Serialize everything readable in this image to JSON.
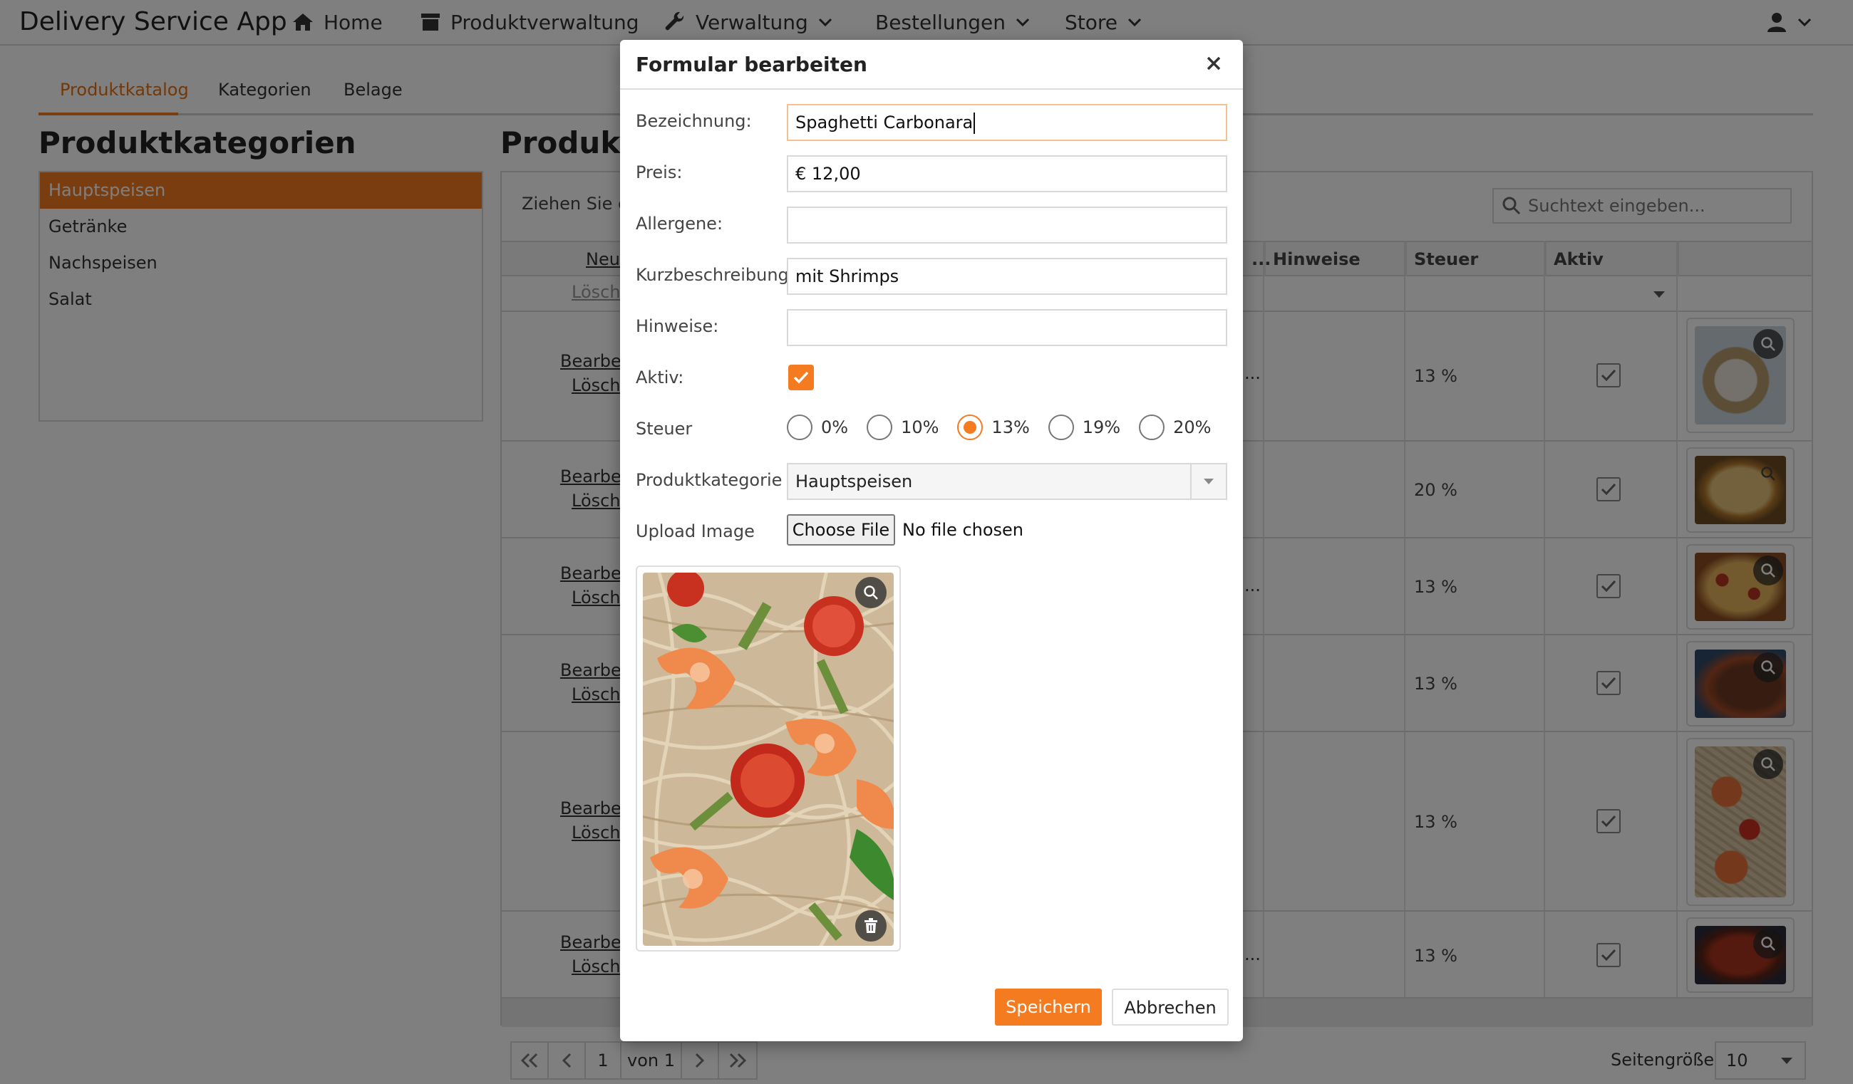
{
  "app": {
    "brand": "Delivery Service App",
    "nav": [
      {
        "label": "Home",
        "icon": "home-icon"
      },
      {
        "label": "Produktverwaltung",
        "icon": "archive-icon"
      },
      {
        "label": "Verwaltung",
        "icon": "wrench-icon"
      },
      {
        "label": "Bestellungen"
      },
      {
        "label": "Store"
      }
    ],
    "user_icon": "user-icon"
  },
  "tabs": [
    {
      "label": "Produktkatalog",
      "active": true
    },
    {
      "label": "Kategorien",
      "active": false
    },
    {
      "label": "Belage",
      "active": false
    }
  ],
  "categories": {
    "title": "Produktkategorien",
    "items": [
      "Hauptspeisen",
      "Getränke",
      "Nachspeisen",
      "Salat"
    ],
    "selected": "Hauptspeisen"
  },
  "products": {
    "title": "Produkte",
    "drag_hint": "Ziehen Sie ei",
    "search_placeholder": "Suchtext eingeben...",
    "header": {
      "new_link": "Neu",
      "ellipsis": "...",
      "hinweise": "Hinweise",
      "steuer": "Steuer",
      "aktiv": "Aktiv"
    },
    "filter_delete": "Lösche",
    "rows": [
      {
        "edit": "Bearbeit",
        "delete": "Lösche",
        "truncated": "...",
        "tax": "13 %",
        "active": true
      },
      {
        "edit": "Bearbeit",
        "delete": "Lösche",
        "truncated": "",
        "tax": "20 %",
        "active": true
      },
      {
        "edit": "Bearbeit",
        "delete": "Lösche",
        "truncated": "...",
        "tax": "13 %",
        "active": true
      },
      {
        "edit": "Bearbeit",
        "delete": "Lösche",
        "truncated": "",
        "tax": "13 %",
        "active": true
      },
      {
        "edit": "Bearbeit",
        "delete": "Lösche",
        "truncated": "",
        "tax": "13 %",
        "active": true
      },
      {
        "edit": "Bearbeit",
        "delete": "Lösche",
        "truncated": "...",
        "tax": "13 %",
        "active": true
      }
    ],
    "pager": {
      "page": "1",
      "of": "von 1",
      "page_size_label": "Seitengröße:",
      "page_size": "10"
    }
  },
  "modal": {
    "title": "Formular bearbeiten",
    "fields": {
      "bezeichnung_label": "Bezeichnung:",
      "bezeichnung_value": "Spaghetti Carbonara",
      "preis_label": "Preis:",
      "preis_value": "€ 12,00",
      "allergene_label": "Allergene:",
      "allergene_value": "",
      "kurz_label": "Kurzbeschreibung:",
      "kurz_value": "mit Shrimps",
      "hinweise_label": "Hinweise:",
      "hinweise_value": "",
      "aktiv_label": "Aktiv:",
      "aktiv_checked": true,
      "steuer_label": "Steuer",
      "steuer_options": [
        "0%",
        "10%",
        "13%",
        "19%",
        "20%"
      ],
      "steuer_selected": "13%",
      "kategorie_label": "Produktkategorie",
      "kategorie_value": "Hauptspeisen",
      "upload_label": "Upload Image",
      "file_button": "Choose File",
      "file_status": "No file chosen"
    },
    "save": "Speichern",
    "cancel": "Abbrechen"
  },
  "colors": {
    "accent": "#f47b20",
    "overlay": "rgba(0,0,0,0.5)"
  }
}
